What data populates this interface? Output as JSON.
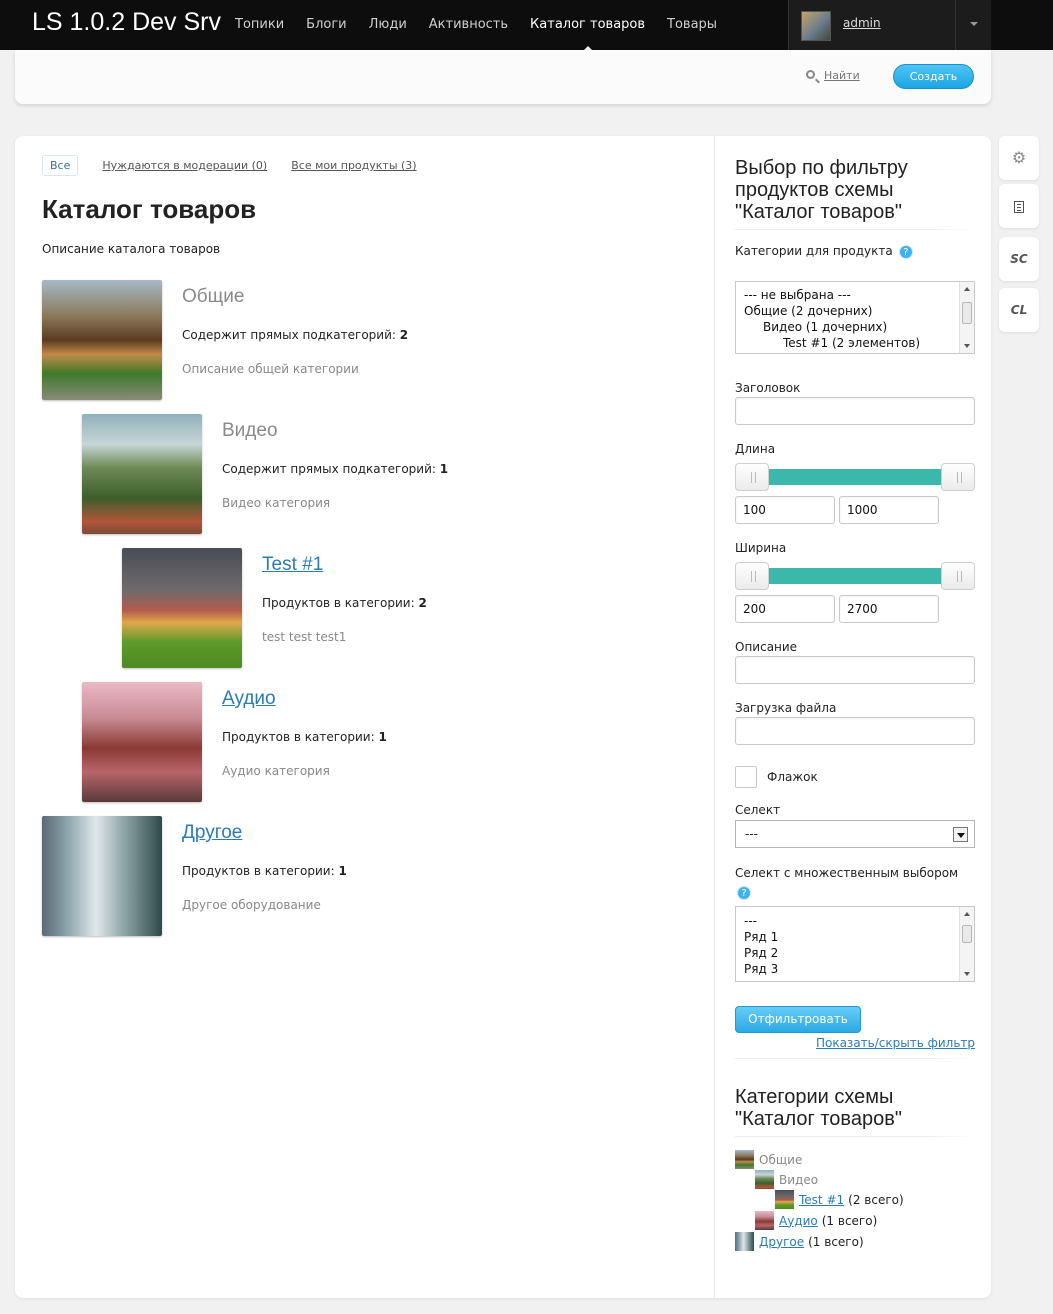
{
  "header": {
    "brand": "LS 1.0.2 Dev Srv",
    "nav": [
      "Топики",
      "Блоги",
      "Люди",
      "Активность",
      "Каталог товаров",
      "Товары"
    ],
    "active_nav": "Каталог товаров",
    "username": "admin"
  },
  "subheader": {
    "search_label": "Найти",
    "create_label": "Создать"
  },
  "tabs": {
    "all": "Все",
    "moderation": "Нуждаются в модерации (0)",
    "mine": "Все мои продукты (3)"
  },
  "page": {
    "title": "Каталог товаров",
    "description": "Описание каталога товаров"
  },
  "categories": [
    {
      "title": "Общие",
      "count_label": "Содержит прямых подкатегорий:",
      "count": "2",
      "desc": "Описание общей категории",
      "level": 0,
      "link": false
    },
    {
      "title": "Видео",
      "count_label": "Содержит прямых подкатегорий:",
      "count": "1",
      "desc": "Видео категория",
      "level": 1,
      "link": false
    },
    {
      "title": "Test #1",
      "count_label": "Продуктов в категории:",
      "count": "2",
      "desc": "test test test1",
      "level": 2,
      "link": true
    },
    {
      "title": "Аудио",
      "count_label": "Продуктов в категории:",
      "count": "1",
      "desc": "Аудио категория",
      "level": 1,
      "link": true
    },
    {
      "title": "Другое",
      "count_label": "Продуктов в категории:",
      "count": "1",
      "desc": "Другое оборудование",
      "level": 0,
      "link": true
    }
  ],
  "filter": {
    "title": "Выбор по фильтру продуктов схемы \"Каталог товаров\"",
    "category_label": "Категории для продукта",
    "category_options": [
      "--- не выбрана ---",
      "Общие (2 дочерних)",
      "Видео (1 дочерних)",
      "Test #1 (2 элементов)"
    ],
    "title_label": "Заголовок",
    "title_value": "",
    "length_label": "Длина",
    "length_min": "100",
    "length_max": "1000",
    "width_label": "Ширина",
    "width_min": "200",
    "width_max": "2700",
    "desc_label": "Описание",
    "desc_value": "",
    "file_label": "Загрузка файла",
    "checkbox_label": "Флажок",
    "select_label": "Селект",
    "select_value": "---",
    "multiselect_label": "Селект с множественным выбором",
    "multiselect_options": [
      "---",
      "Ряд 1",
      "Ряд 2",
      "Ряд 3"
    ],
    "submit_label": "Отфильтровать",
    "toggle_label": "Показать/скрыть фильтр"
  },
  "tree": {
    "title": "Категории схемы \"Каталог товаров\"",
    "items": [
      {
        "label": "Общие",
        "count": "",
        "level": 0,
        "link": false
      },
      {
        "label": "Видео",
        "count": "",
        "level": 1,
        "link": false
      },
      {
        "label": "Test #1",
        "count": "(2 всего)",
        "level": 2,
        "link": true
      },
      {
        "label": "Аудио",
        "count": "(1 всего)",
        "level": 1,
        "link": true
      },
      {
        "label": "Другое",
        "count": "(1 всего)",
        "level": 0,
        "link": true
      }
    ]
  },
  "tools": {
    "settings": "gear-icon",
    "document": "document-icon",
    "sc": "SC",
    "cl": "CL"
  }
}
